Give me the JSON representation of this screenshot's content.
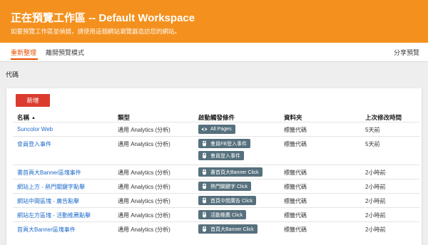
{
  "banner": {
    "title": "正在預覽工作區 -- Default Workspace",
    "subtitle": "如要預覽工作區並偵錯，請使用這個網站瀏覽器造訪您的網站。"
  },
  "toolbar": {
    "refresh_label": "重新整理",
    "leave_label": "離開預覽模式",
    "share_label": "分享預覽"
  },
  "section": {
    "label": "代碼"
  },
  "card": {
    "new_button_label": "新增",
    "columns": {
      "name": "名稱",
      "type": "類型",
      "triggers": "啟動觸發條件",
      "folder": "資料夾",
      "last_edited": "上次修改時間"
    },
    "rows": [
      {
        "name": "Suncolor Web",
        "type": "通用 Analytics (分析)",
        "triggers": [
          {
            "label": "All Pages",
            "icon": "eye-icon"
          }
        ],
        "folder": "標籤代碼",
        "edited": "5天前"
      },
      {
        "name": "會員登入事件",
        "type": "通用 Analytics (分析)",
        "triggers": [
          {
            "label": "會員FB登入事件",
            "icon": "mouse-icon"
          },
          {
            "label": "會員登入事件",
            "icon": "mouse-icon"
          }
        ],
        "folder": "標籤代碼",
        "edited": "5天前"
      },
      {
        "name": "書首頁大Banner區塊事件",
        "type": "通用 Analytics (分析)",
        "triggers": [
          {
            "label": "書首頁大Banner Click",
            "icon": "mouse-icon"
          }
        ],
        "folder": "標籤代碼",
        "edited": "2小時前"
      },
      {
        "name": "網站上方 - 熱門關鍵字點擊",
        "type": "通用 Analytics (分析)",
        "triggers": [
          {
            "label": "熱門關鍵字 Click",
            "icon": "mouse-icon"
          }
        ],
        "folder": "標籤代碼",
        "edited": "2小時前"
      },
      {
        "name": "網站中間區塊 - 廣告點擊",
        "type": "通用 Analytics (分析)",
        "triggers": [
          {
            "label": "首頁中間廣告 Click",
            "icon": "mouse-icon"
          }
        ],
        "folder": "標籤代碼",
        "edited": "2小時前"
      },
      {
        "name": "網站左方區塊 - 活動推薦點擊",
        "type": "通用 Analytics (分析)",
        "triggers": [
          {
            "label": "活動推薦 Click",
            "icon": "mouse-icon"
          }
        ],
        "folder": "標籤代碼",
        "edited": "2小時前"
      },
      {
        "name": "首頁大Banner區塊事件",
        "type": "通用 Analytics (分析)",
        "triggers": [
          {
            "label": "首頁大Banner Click",
            "icon": "mouse-icon"
          }
        ],
        "folder": "標籤代碼",
        "edited": "2小時前"
      }
    ]
  }
}
